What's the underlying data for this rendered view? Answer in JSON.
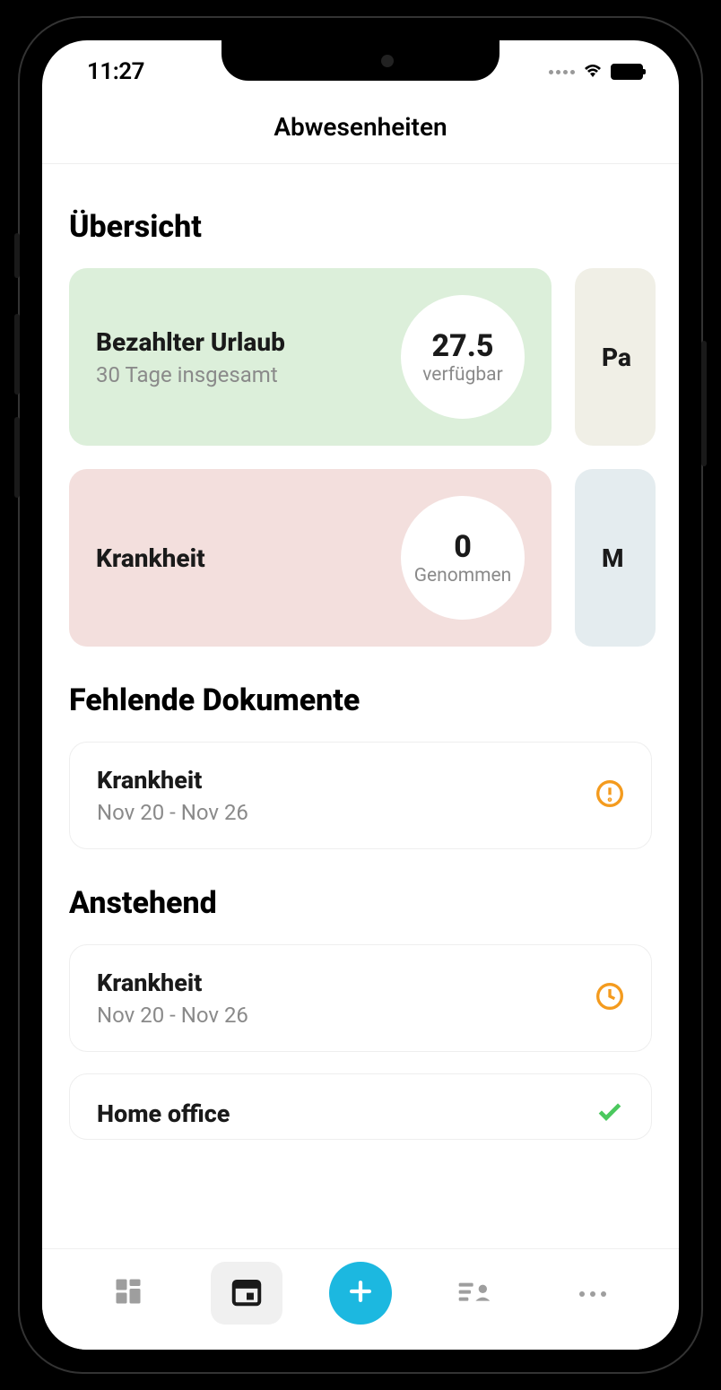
{
  "status": {
    "time": "11:27"
  },
  "header": {
    "title": "Abwesenheiten"
  },
  "overview": {
    "title": "Übersicht",
    "cards": [
      {
        "name": "Bezahlter Urlaub",
        "sub": "30 Tage insgesamt",
        "value": "27.5",
        "value_label": "verfügbar",
        "peek": "Pa"
      },
      {
        "name": "Krankheit",
        "sub": "",
        "value": "0",
        "value_label": "Genommen",
        "peek": "M"
      }
    ]
  },
  "missing": {
    "title": "Fehlende Dokumente",
    "items": [
      {
        "name": "Krankheit",
        "range": "Nov 20 - Nov 26"
      }
    ]
  },
  "pending": {
    "title": "Anstehend",
    "items": [
      {
        "name": "Krankheit",
        "range": "Nov 20 - Nov 26"
      },
      {
        "name": "Home office",
        "range": ""
      }
    ]
  }
}
